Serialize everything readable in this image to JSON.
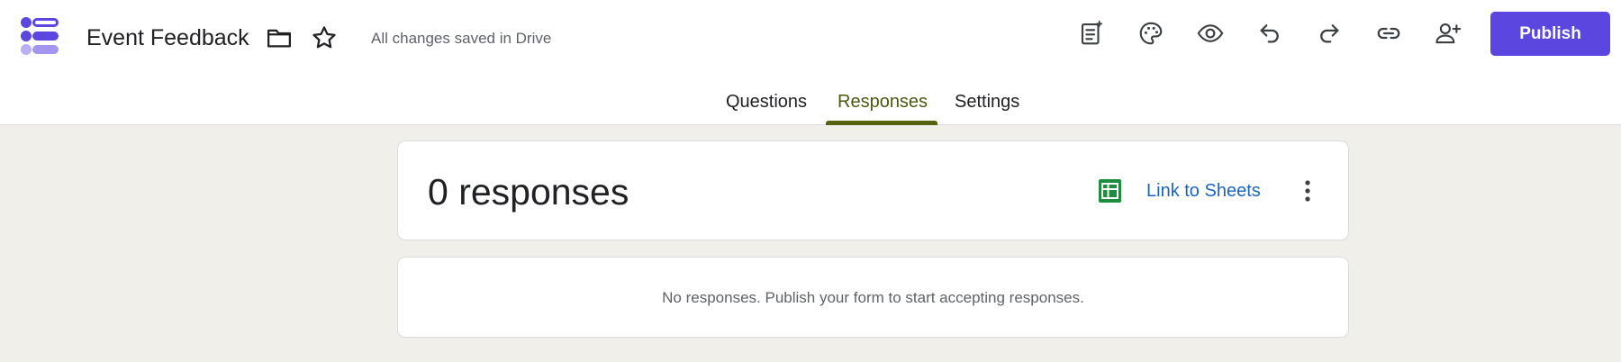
{
  "header": {
    "title": "Event Feedback",
    "save_status": "All changes saved in Drive",
    "publish_label": "Publish",
    "icons": [
      "folder-icon",
      "star-icon",
      "form-ai-icon",
      "palette-icon",
      "preview-eye-icon",
      "undo-icon",
      "redo-icon",
      "link-icon",
      "add-collaborator-icon"
    ]
  },
  "tabs": [
    {
      "label": "Questions",
      "active": false
    },
    {
      "label": "Responses",
      "active": true
    },
    {
      "label": "Settings",
      "active": false
    }
  ],
  "summary": {
    "count_text": "0 responses",
    "link_label": "Link to Sheets"
  },
  "empty_state": {
    "message": "No responses. Publish your form to start accepting responses."
  },
  "colors": {
    "accent": "#5b47e0",
    "active_tab": "#56620f",
    "link": "#1a64c8",
    "sheets_green": "#1e8e3e",
    "background": "#f0efe9"
  }
}
